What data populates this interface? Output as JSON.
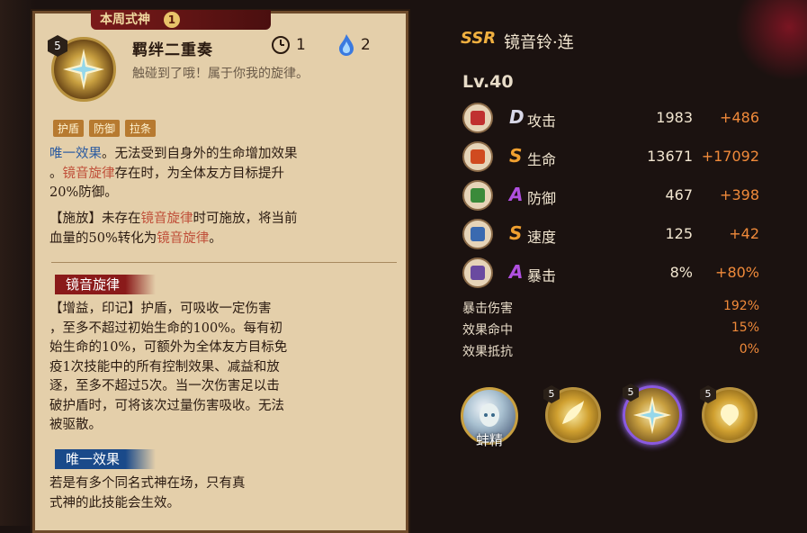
{
  "card": {
    "tab_label": "本周式神",
    "tab_number": "1",
    "skill": {
      "level": "5",
      "name": "羁绊二重奏",
      "cooldown": "1",
      "fire_cost": "2",
      "quote": "触碰到了哦！属于你我的旋律。",
      "tags": [
        "护盾",
        "防御",
        "拉条"
      ]
    },
    "para1": {
      "a": "唯一效果",
      "b": "。无法受到自身外的生命增加效果",
      "c": "。",
      "d": "镜音旋律",
      "e": "存在时，为全体友方目标提升",
      "f": "20%防御。"
    },
    "para2": {
      "a": "【施放】未存在",
      "b": "镜音旋律",
      "c": "时可施放，将当前",
      "d": "血量的50%转化为",
      "e": "镜音旋律",
      "f": "。"
    },
    "ribbon1": "镜音旋律",
    "para3": [
      "【增益，印记】护盾，可吸收一定伤害",
      "，至多不超过初始生命的100%。每有初",
      "始生命的10%，可额外为全体友方目标免",
      "疫1次技能中的所有控制效果、减益和放",
      "逐，至多不超过5次。当一次伤害足以击",
      "破护盾时，可将该次过量伤害吸收。无法",
      "被驱散。"
    ],
    "ribbon2": "唯一效果",
    "para4": [
      "若是有多个同名式神在场，只有真",
      "式神的此技能会生效。"
    ]
  },
  "character": {
    "rarity": "SSR",
    "name": "镜音铃·连",
    "level": "Lv.40"
  },
  "stats": [
    {
      "grade": "D",
      "label": "攻击",
      "base": "1983",
      "bonus": "+486",
      "grade_color": "#d8d8e8",
      "icon": "attack-icon",
      "icon_color": "#c03030"
    },
    {
      "grade": "S",
      "label": "生命",
      "base": "13671",
      "bonus": "+17092",
      "grade_color": "#f0a030",
      "icon": "health-icon",
      "icon_color": "#d04a20"
    },
    {
      "grade": "A",
      "label": "防御",
      "base": "467",
      "bonus": "+398",
      "grade_color": "#b050e0",
      "icon": "defense-icon",
      "icon_color": "#3a8a3a"
    },
    {
      "grade": "S",
      "label": "速度",
      "base": "125",
      "bonus": "+42",
      "grade_color": "#f0a030",
      "icon": "speed-icon",
      "icon_color": "#3a6ab0"
    },
    {
      "grade": "A",
      "label": "暴击",
      "base": "8%",
      "bonus": "+80%",
      "grade_color": "#b050e0",
      "icon": "crit-icon",
      "icon_color": "#6a4aa0"
    }
  ],
  "substats": [
    {
      "label": "暴击伤害",
      "value": "192%"
    },
    {
      "label": "效果命中",
      "value": "15%"
    },
    {
      "label": "效果抵抗",
      "value": "0%"
    }
  ],
  "partner": {
    "label": "蚌精"
  },
  "skill_slots": [
    {
      "level": "5",
      "icon": "skill-1-icon",
      "selected": false
    },
    {
      "level": "5",
      "icon": "skill-2-icon",
      "selected": true
    },
    {
      "level": "5",
      "icon": "skill-3-icon",
      "selected": false
    }
  ]
}
